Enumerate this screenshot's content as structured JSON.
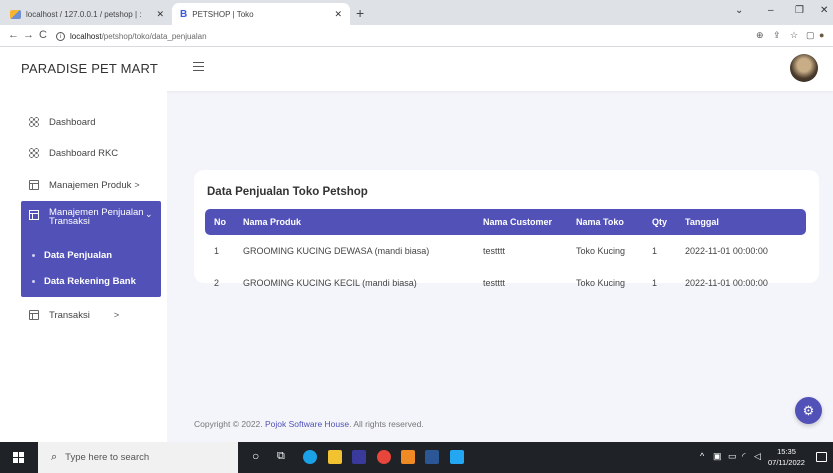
{
  "browser": {
    "tabs": [
      {
        "title": "localhost / 127.0.0.1 / petshop | :",
        "active": false
      },
      {
        "title": "PETSHOP | Toko",
        "active": true
      }
    ],
    "url_host": "localhost",
    "url_path": "/petshop/toko/data_penjualan"
  },
  "app": {
    "brand": "PARADISE PET MART"
  },
  "sidebar": {
    "items": [
      {
        "label": "Dashboard",
        "icon": "grid-icon"
      },
      {
        "label": "Dashboard RKC",
        "icon": "grid-icon"
      },
      {
        "label": "Manajemen Produk",
        "icon": "table-icon"
      }
    ],
    "open_section": {
      "label_line1": "Manajemen Penjualan",
      "label_line2": "Transaksi",
      "sub_items": [
        "Data Penjualan",
        "Data Rekening Bank"
      ]
    },
    "transaksi_label": "Transaksi"
  },
  "card": {
    "title": "Data Penjualan Toko Petshop",
    "columns": [
      "No",
      "Nama Produk",
      "Nama Customer",
      "Nama Toko",
      "Qty",
      "Tanggal"
    ],
    "rows": [
      [
        "1",
        "GROOMING KUCING DEWASA (mandi biasa)",
        "testttt",
        "Toko Kucing",
        "1",
        "2022-11-01 00:00:00"
      ],
      [
        "2",
        "GROOMING KUCING KECIL (mandi biasa)",
        "testttt",
        "Toko Kucing",
        "1",
        "2022-11-01 00:00:00"
      ]
    ]
  },
  "footer": {
    "prefix": "Copyright © 2022. ",
    "link": "Pojok Software House",
    "suffix": ". All rights reserved."
  },
  "taskbar": {
    "search_placeholder": "Type here to search",
    "time": "15:35",
    "date": "07/11/2022"
  },
  "colors": {
    "accent": "#5151b8",
    "page_bg": "#f4f5fa"
  }
}
